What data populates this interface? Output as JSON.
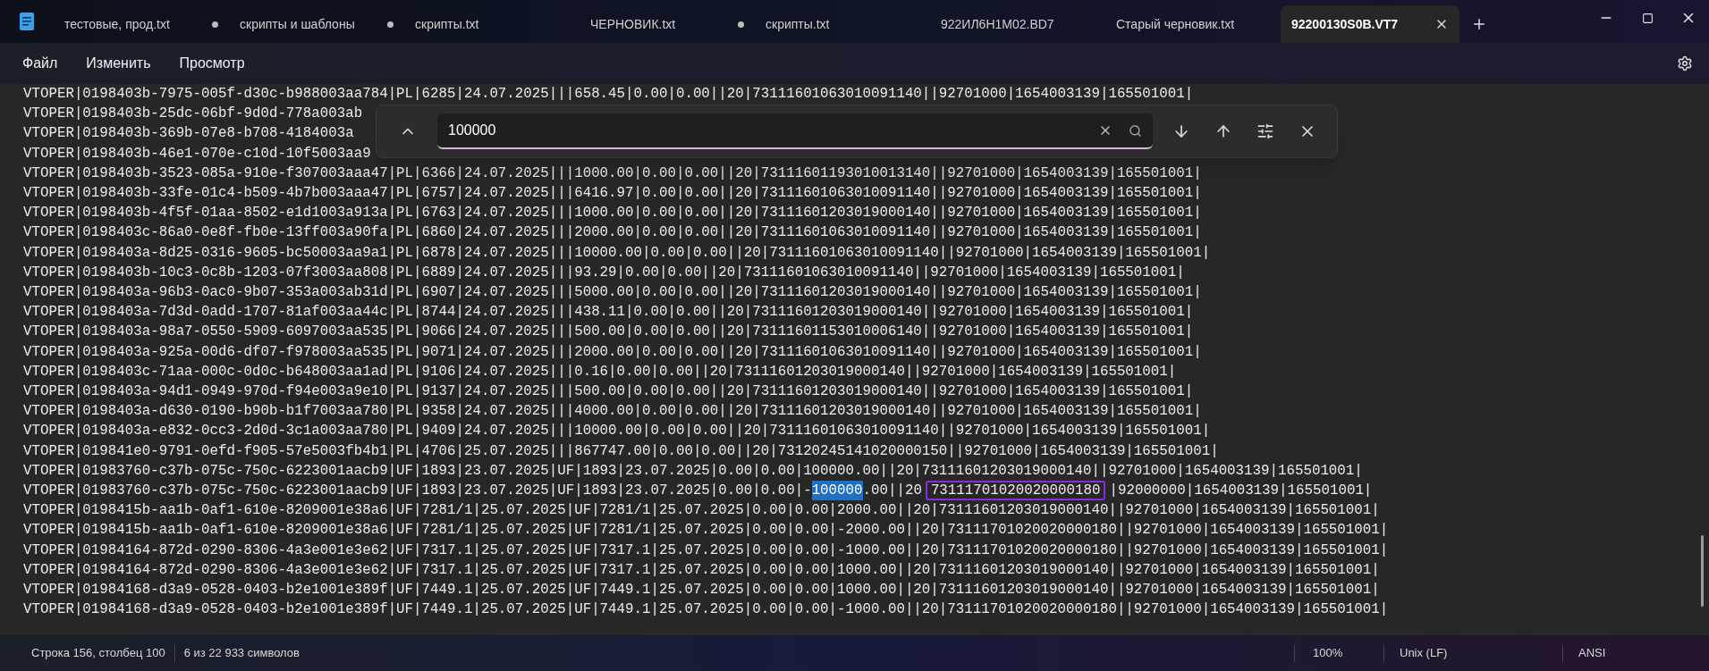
{
  "tabs": [
    {
      "label": "тестовые, прод.txt",
      "modified": true,
      "selected": false
    },
    {
      "label": "скрипты и шаблоны",
      "modified": true,
      "selected": false
    },
    {
      "label": "скрипты.txt",
      "modified": false,
      "selected": false
    },
    {
      "label": "ЧЕРНОВИК.txt",
      "modified": true,
      "selected": false
    },
    {
      "label": "скрипты.txt",
      "modified": false,
      "selected": false
    },
    {
      "label": "922ИЛ6Н1М02.BD7",
      "modified": false,
      "selected": false
    },
    {
      "label": "Старый черновик.txt",
      "modified": false,
      "selected": false
    },
    {
      "label": "92200130S0B.VT7",
      "modified": false,
      "selected": true
    }
  ],
  "menu": [
    "Файл",
    "Изменить",
    "Просмотр"
  ],
  "find": {
    "value": "100000"
  },
  "lines": [
    {
      "kind": "plain",
      "text": "VTOPER|0198403b-7975-005f-d30c-b988003aa784|PL|6285|24.07.2025|||658.45|0.00|0.00||20|73111601063010091140||92701000|1654003139|165501001|"
    },
    {
      "kind": "plain",
      "text": "VTOPER|0198403b-25dc-06bf-9d0d-778a003ab"
    },
    {
      "kind": "plain",
      "text": "VTOPER|0198403b-369b-07e8-b708-4184003a"
    },
    {
      "kind": "plain",
      "text": "VTOPER|0198403b-46e1-070e-c10d-10f5003aa9"
    },
    {
      "kind": "plain",
      "text": "VTOPER|0198403b-3523-085a-910e-f307003aaa47|PL|6366|24.07.2025|||1000.00|0.00|0.00||20|73111601193010013140||92701000|1654003139|165501001|"
    },
    {
      "kind": "plain",
      "text": "VTOPER|0198403b-33fe-01c4-b509-4b7b003aaa47|PL|6757|24.07.2025|||6416.97|0.00|0.00||20|73111601063010091140||92701000|1654003139|165501001|"
    },
    {
      "kind": "plain",
      "text": "VTOPER|0198403b-4f5f-01aa-8502-e1d1003a913a|PL|6763|24.07.2025|||1000.00|0.00|0.00||20|73111601203019000140||92701000|1654003139|165501001|"
    },
    {
      "kind": "plain",
      "text": "VTOPER|0198403c-86a0-0e8f-fb0e-13ff003a90fa|PL|6860|24.07.2025|||2000.00|0.00|0.00||20|73111601063010091140||92701000|1654003139|165501001|"
    },
    {
      "kind": "plain",
      "text": "VTOPER|0198403a-8d25-0316-9605-bc50003aa9a1|PL|6878|24.07.2025|||10000.00|0.00|0.00||20|73111601063010091140||92701000|1654003139|165501001|"
    },
    {
      "kind": "plain",
      "text": "VTOPER|0198403b-10c3-0c8b-1203-07f3003aa808|PL|6889|24.07.2025|||93.29|0.00|0.00||20|73111601063010091140||92701000|1654003139|165501001|"
    },
    {
      "kind": "plain",
      "text": "VTOPER|0198403a-96b3-0ac0-9b07-353a003ab31d|PL|6907|24.07.2025|||5000.00|0.00|0.00||20|73111601203019000140||92701000|1654003139|165501001|"
    },
    {
      "kind": "plain",
      "text": "VTOPER|0198403a-7d3d-0add-1707-81af003aa44c|PL|8744|24.07.2025|||438.11|0.00|0.00||20|73111601203019000140||92701000|1654003139|165501001|"
    },
    {
      "kind": "plain",
      "text": "VTOPER|0198403a-98a7-0550-5909-6097003aa535|PL|9066|24.07.2025|||500.00|0.00|0.00||20|73111601153010006140||92701000|1654003139|165501001|"
    },
    {
      "kind": "plain",
      "text": "VTOPER|0198403a-925a-00d6-df07-f978003aa535|PL|9071|24.07.2025|||2000.00|0.00|0.00||20|73111601063010091140||92701000|1654003139|165501001|"
    },
    {
      "kind": "plain",
      "text": "VTOPER|0198403c-71aa-000c-0d0c-b648003aa1ad|PL|9106|24.07.2025|||0.16|0.00|0.00||20|73111601203019000140||92701000|1654003139|165501001|"
    },
    {
      "kind": "plain",
      "text": "VTOPER|0198403a-94d1-0949-970d-f94e003a9e10|PL|9137|24.07.2025|||500.00|0.00|0.00||20|73111601203019000140||92701000|1654003139|165501001|"
    },
    {
      "kind": "plain",
      "text": "VTOPER|0198403a-d630-0190-b90b-b1f7003aa780|PL|9358|24.07.2025|||4000.00|0.00|0.00||20|73111601203019000140||92701000|1654003139|165501001|"
    },
    {
      "kind": "plain",
      "text": "VTOPER|0198403a-e832-0cc3-2d0d-3c1a003aa780|PL|9409|24.07.2025|||10000.00|0.00|0.00||20|73111601063010091140||92701000|1654003139|165501001|"
    },
    {
      "kind": "plain",
      "text": "VTOPER|019841e0-9791-0efd-f905-57e5003fb4b1|PL|4706|25.07.2025|||867747.00|0.00|0.00||20|73120245141020000150||92701000|1654003139|165501001|"
    },
    {
      "kind": "plain",
      "text": "VTOPER|01983760-c37b-075c-750c-6223001aacb9|UF|1893|23.07.2025|UF|1893|23.07.2025|0.00|0.00|100000.00||20|73111601203019000140||92701000|1654003139|165501001|"
    },
    {
      "kind": "marked",
      "parts": [
        {
          "kind": "text",
          "text": "VTOPER|01983760-c37b-075c-750c-6223001aacb9|UF|1893|23.07.2025|UF|1893|23.07.2025|0.00|0.00|-"
        },
        {
          "kind": "match",
          "text": "100000"
        },
        {
          "kind": "text",
          "text": ".00||20"
        },
        {
          "kind": "boxed",
          "text": "73111701020020000180"
        },
        {
          "kind": "text",
          "text": "|92000000|1654003139|165501001|"
        }
      ]
    },
    {
      "kind": "plain",
      "text": "VTOPER|0198415b-aa1b-0af1-610e-8209001e38a6|UF|7281/1|25.07.2025|UF|7281/1|25.07.2025|0.00|0.00|2000.00||20|73111601203019000140||92701000|1654003139|165501001|"
    },
    {
      "kind": "plain",
      "text": "VTOPER|0198415b-aa1b-0af1-610e-8209001e38a6|UF|7281/1|25.07.2025|UF|7281/1|25.07.2025|0.00|0.00|-2000.00||20|73111701020020000180||92701000|1654003139|165501001|"
    },
    {
      "kind": "plain",
      "text": "VTOPER|01984164-872d-0290-8306-4a3e001e3e62|UF|7317.1|25.07.2025|UF|7317.1|25.07.2025|0.00|0.00|-1000.00||20|73111701020020000180||92701000|1654003139|165501001|"
    },
    {
      "kind": "plain",
      "text": "VTOPER|01984164-872d-0290-8306-4a3e001e3e62|UF|7317.1|25.07.2025|UF|7317.1|25.07.2025|0.00|0.00|1000.00||20|73111601203019000140||92701000|1654003139|165501001|"
    },
    {
      "kind": "plain",
      "text": "VTOPER|01984168-d3a9-0528-0403-b2e1001e389f|UF|7449.1|25.07.2025|UF|7449.1|25.07.2025|0.00|0.00|1000.00||20|73111601203019000140||92701000|1654003139|165501001|"
    },
    {
      "kind": "plain",
      "text": "VTOPER|01984168-d3a9-0528-0403-b2e1001e389f|UF|7449.1|25.07.2025|UF|7449.1|25.07.2025|0.00|0.00|-1000.00||20|73111701020020000180||92701000|1654003139|165501001|"
    }
  ],
  "status": {
    "position": "Строка 156, столбец 100",
    "count": "6 из 22 933 символов",
    "zoom": "100%",
    "line_ending": "Unix (LF)",
    "encoding": "ANSI"
  }
}
